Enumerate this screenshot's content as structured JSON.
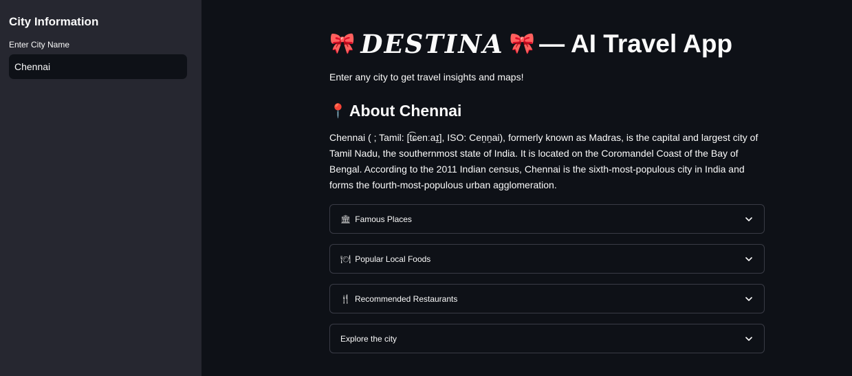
{
  "sidebar": {
    "title": "City Information",
    "city_label": "Enter City Name",
    "city_value": "Chennai"
  },
  "header": {
    "bow": "🎀",
    "brand": "DESTINA",
    "title_rest": "— AI Travel App"
  },
  "intro": "Enter any city to get travel insights and maps!",
  "about": {
    "pin": "📍",
    "heading": "About Chennai",
    "text": "Chennai ( ; Tamil: [t͡ɕenːaɪ̯], ISO: Ceṉṉai), formerly known as Madras, is the capital and largest city of Tamil Nadu, the southernmost state of India. It is located on the Coromandel Coast of the Bay of Bengal. According to the 2011 Indian census, Chennai is the sixth-most-populous city in India and forms the fourth-most-populous urban agglomeration."
  },
  "expanders": [
    {
      "icon": "🏛",
      "label": "Famous Places"
    },
    {
      "icon": "🍽",
      "label": "Popular Local Foods"
    },
    {
      "icon": "🍴",
      "label": "Recommended Restaurants"
    },
    {
      "icon": "",
      "label": "Explore the city"
    }
  ],
  "icons": {
    "chevron": "chevron-down-icon",
    "pin": "pin-icon",
    "bow": "ribbon-bow-icon"
  },
  "colors": {
    "background": "#0e1117",
    "sidebar": "#262730",
    "border": "#3a3c46",
    "text": "#fafafa"
  }
}
